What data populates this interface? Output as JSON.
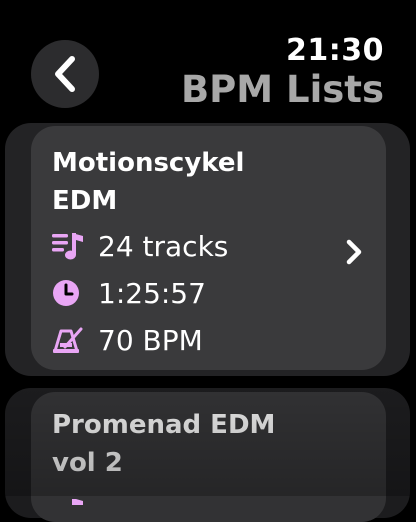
{
  "header": {
    "time": "21:30",
    "title": "BPM Lists"
  },
  "lists": [
    {
      "name": "Motionscykel EDM",
      "name_line1": "Motionscykel",
      "name_line2": "EDM",
      "tracks": "24 tracks",
      "duration": "1:25:57",
      "bpm": "70 BPM"
    },
    {
      "name": "Promenad EDM vol 2",
      "name_line1": "Promenad EDM",
      "name_line2": "vol 2"
    }
  ],
  "colors": {
    "accent": "#e9a6f5",
    "title_gray": "#a8a8a8",
    "card": "#3a3a3c",
    "card_outer": "#232325"
  },
  "icons": {
    "back": "chevron-left-icon",
    "tracks": "music-list-icon",
    "duration": "clock-icon",
    "bpm": "metronome-icon",
    "open": "chevron-right-icon"
  }
}
